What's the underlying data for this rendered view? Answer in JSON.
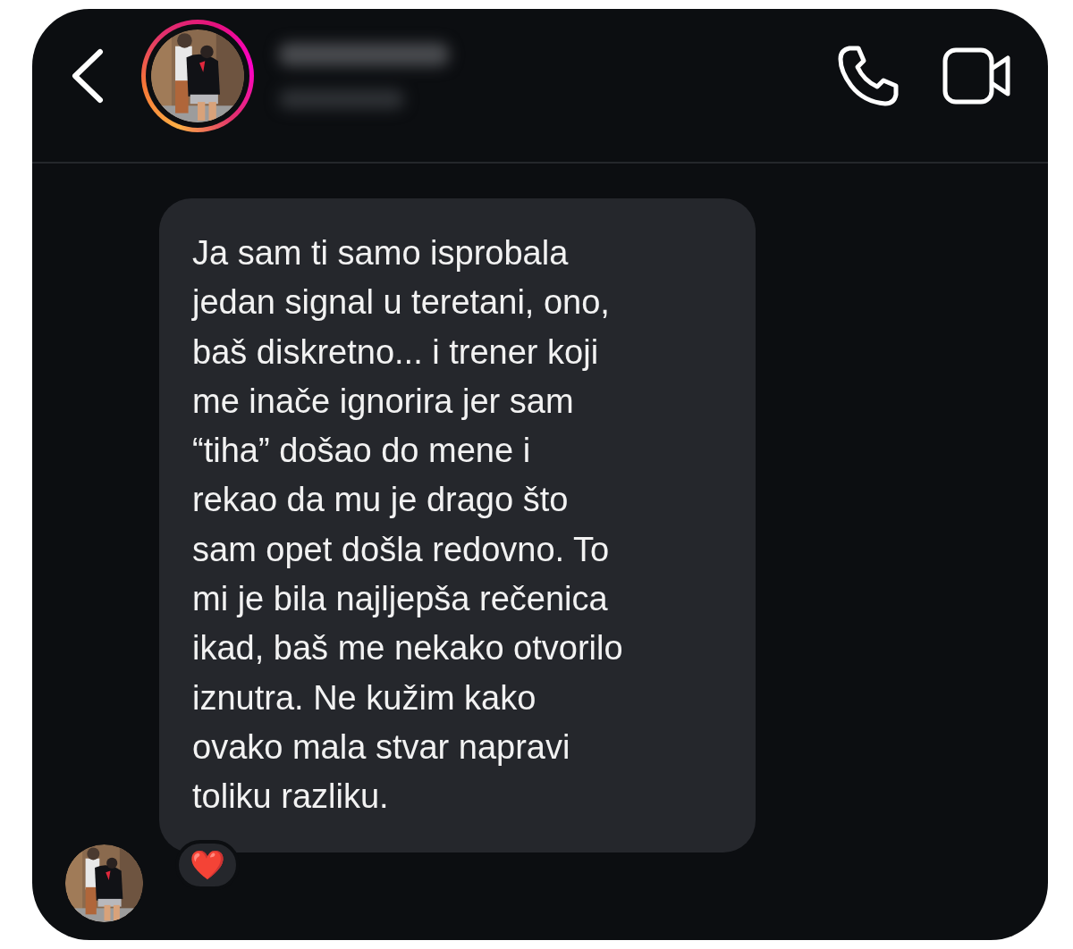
{
  "header": {
    "story_ring": true
  },
  "message": {
    "lines": [
      "Ja sam ti samo isprobala",
      "jedan signal u teretani, ono,",
      "baš diskretno... i trener koji",
      "me inače ignorira jer sam",
      "“tiha” došao do mene i",
      "rekao da mu je drago što",
      "sam opet došla redovno. To",
      "mi je bila najljepša rečenica",
      "ikad, baš me nekako otvorilo",
      "iznutra. Ne kužim kako",
      "ovako mala stvar napravi",
      "toliku razliku."
    ],
    "reaction": "❤️"
  }
}
